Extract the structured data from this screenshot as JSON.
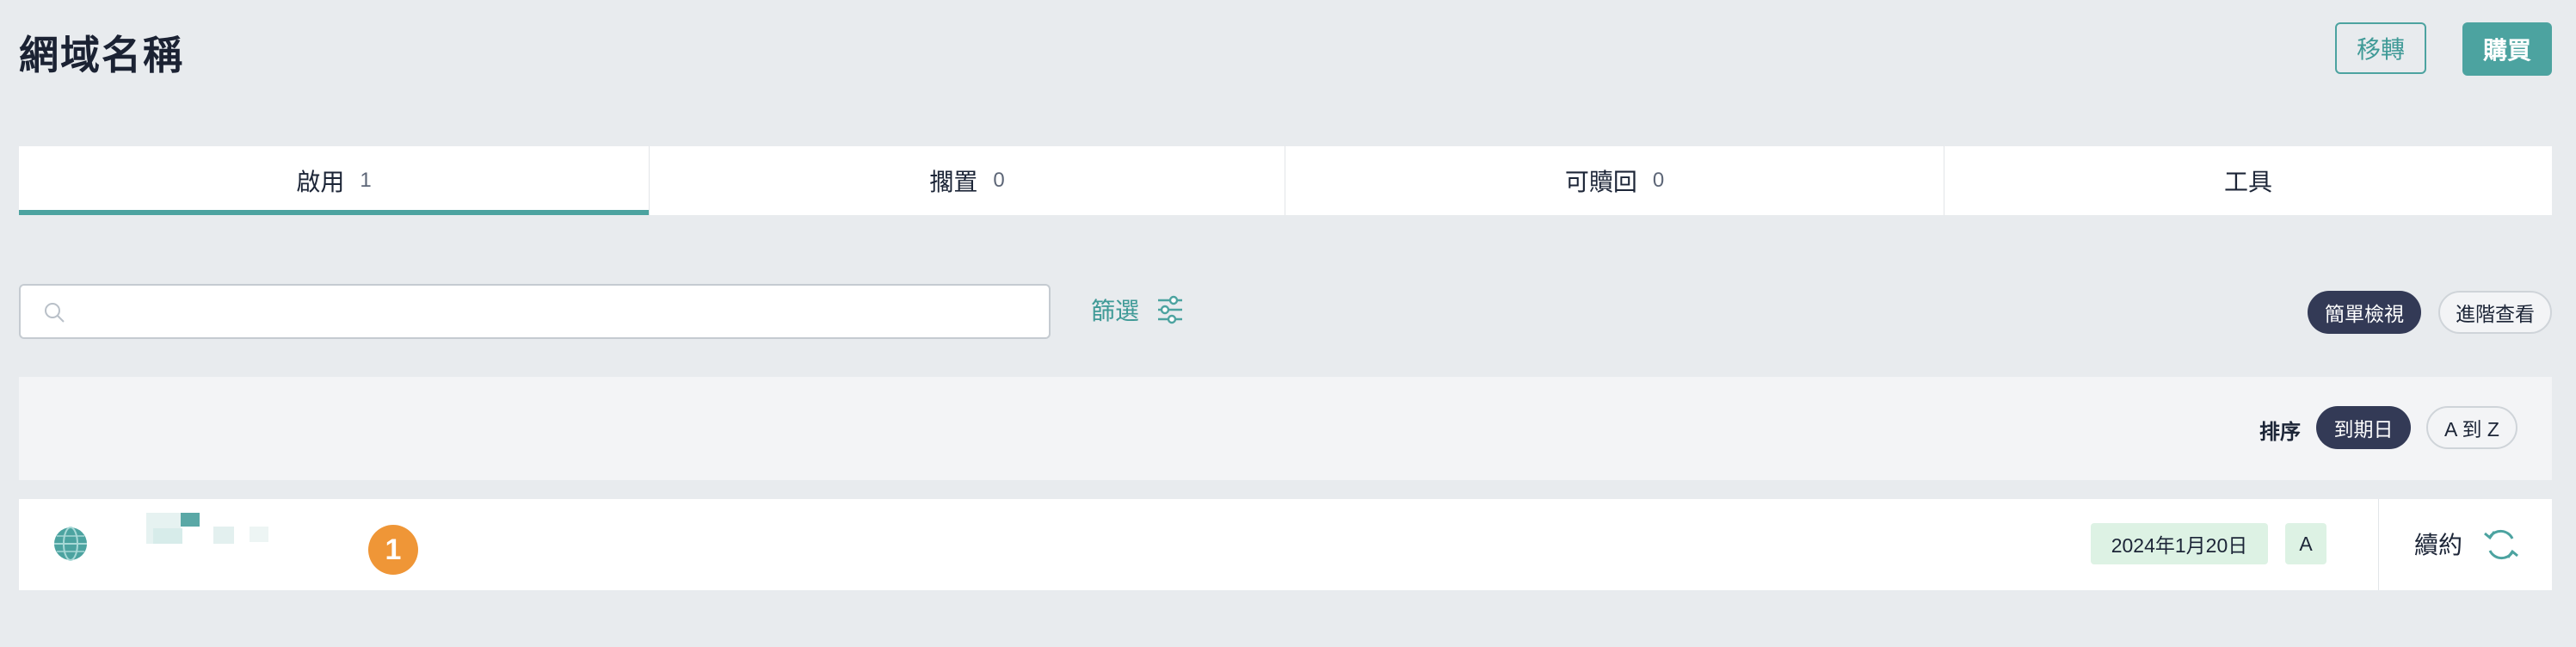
{
  "header": {
    "title": "網域名稱",
    "transfer_label": "移轉",
    "buy_label": "購買"
  },
  "tabs": [
    {
      "label": "啟用",
      "count": "1"
    },
    {
      "label": "擱置",
      "count": "0"
    },
    {
      "label": "可贖回",
      "count": "0"
    },
    {
      "label": "工具",
      "count": ""
    }
  ],
  "search": {
    "placeholder": ""
  },
  "filter": {
    "label": "篩選"
  },
  "view": {
    "simple": "簡單檢視",
    "advanced": "進階查看"
  },
  "sort": {
    "label": "排序",
    "expiry": "到期日",
    "az": "A 到 Z"
  },
  "domains": [
    {
      "count_badge": "1",
      "expiry": "2024年1月20日",
      "status": "A",
      "renew": "續約"
    }
  ],
  "colors": {
    "accent": "#4ca3a0",
    "dark_pill": "#333a56",
    "badge_orange": "#ef9637",
    "status_green": "#ddf2e4"
  }
}
